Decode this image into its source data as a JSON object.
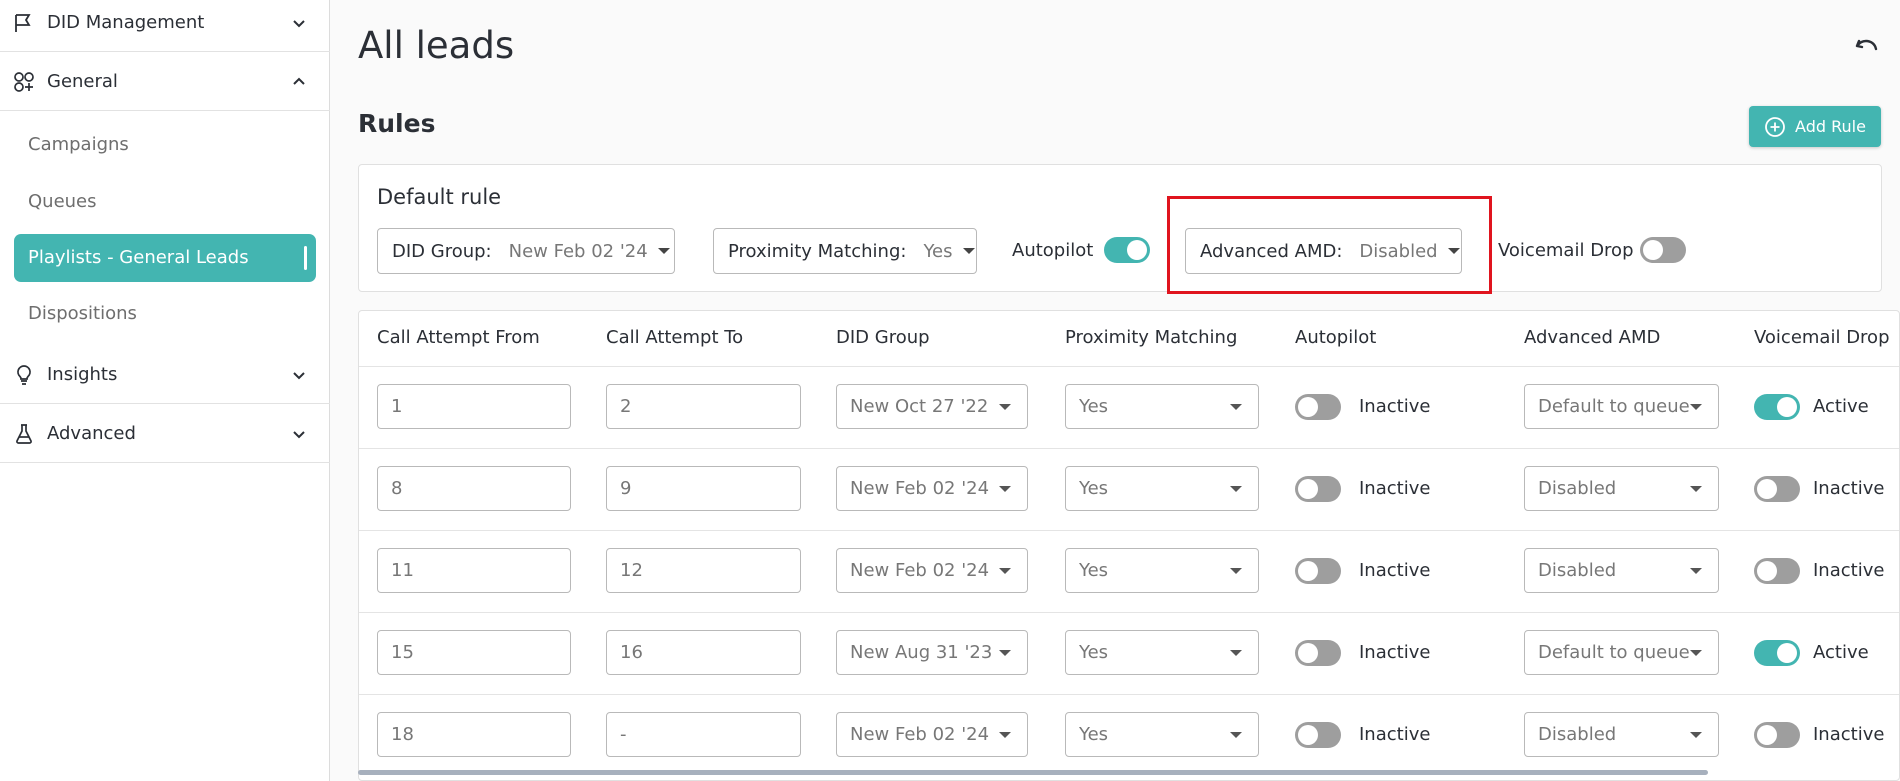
{
  "sidebar": {
    "sections": [
      {
        "label": "DID Management",
        "icon": "flag-icon",
        "chevron": "chevron-down-icon"
      },
      {
        "label": "General",
        "icon": "shapes-icon",
        "chevron": "chevron-up-icon"
      },
      {
        "label": "Insights",
        "icon": "lightbulb-icon",
        "chevron": "chevron-down-icon"
      },
      {
        "label": "Advanced",
        "icon": "flask-icon",
        "chevron": "chevron-down-icon"
      }
    ],
    "general_items": [
      "Campaigns",
      "Queues",
      "Playlists - General Leads",
      "Dispositions"
    ],
    "active_item": "Playlists - General Leads"
  },
  "header": {
    "title": "All leads",
    "undo_icon": "undo-icon"
  },
  "rules": {
    "title": "Rules",
    "add_button": "Add Rule"
  },
  "default_rule": {
    "title": "Default rule",
    "did_group_label": "DID Group:",
    "did_group_value": "New Feb 02 '24",
    "proximity_label": "Proximity Matching:",
    "proximity_value": "Yes",
    "autopilot_label": "Autopilot",
    "autopilot_on": true,
    "amd_label": "Advanced AMD:",
    "amd_value": "Disabled",
    "voicemail_label": "Voicemail Drop",
    "voicemail_on": false
  },
  "table": {
    "columns": [
      "Call Attempt From",
      "Call Attempt To",
      "DID Group",
      "Proximity Matching",
      "Autopilot",
      "Advanced AMD",
      "Voicemail Drop"
    ],
    "rows": [
      {
        "from": "1",
        "to": "2",
        "did": "New Oct 27 '22",
        "prox": "Yes",
        "autopilot": "Inactive",
        "amd": "Default to queue",
        "vm": "Active"
      },
      {
        "from": "8",
        "to": "9",
        "did": "New Feb 02 '24",
        "prox": "Yes",
        "autopilot": "Inactive",
        "amd": "Disabled",
        "vm": "Inactive"
      },
      {
        "from": "11",
        "to": "12",
        "did": "New Feb 02 '24",
        "prox": "Yes",
        "autopilot": "Inactive",
        "amd": "Disabled",
        "vm": "Inactive"
      },
      {
        "from": "15",
        "to": "16",
        "did": "New Aug 31 '23",
        "prox": "Yes",
        "autopilot": "Inactive",
        "amd": "Default to queue",
        "vm": "Active"
      },
      {
        "from": "18",
        "to": "-",
        "did": "New Feb 02 '24",
        "prox": "Yes",
        "autopilot": "Inactive",
        "amd": "Disabled",
        "vm": "Inactive"
      }
    ]
  },
  "colors": {
    "accent": "#43b5b1",
    "highlight": "#e0141e",
    "toggle_off": "#9e9e9e"
  }
}
